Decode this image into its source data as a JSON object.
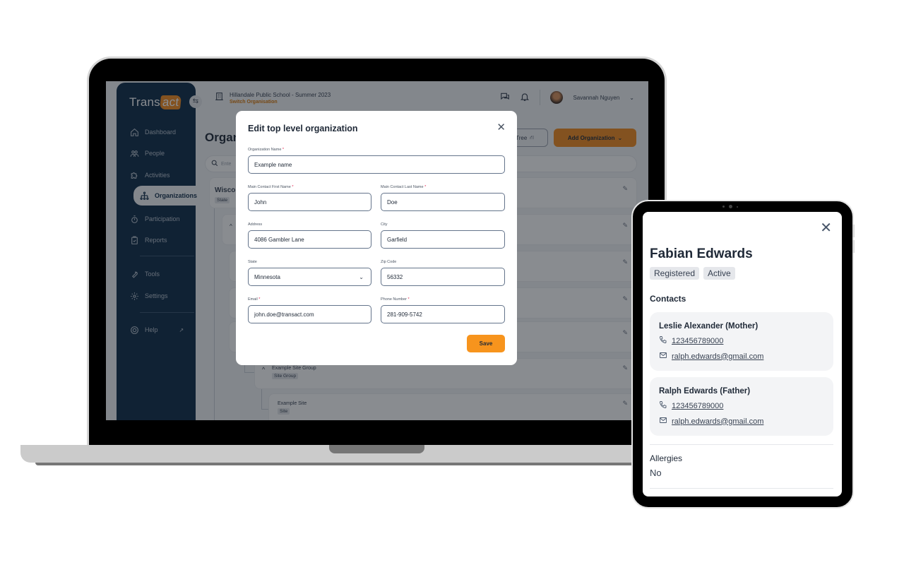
{
  "laptop": {
    "app": {
      "logo": {
        "prefix": "Trans",
        "suffix": "act"
      },
      "sidebar": {
        "items": [
          {
            "label": "Dashboard",
            "icon": "home-icon"
          },
          {
            "label": "People",
            "icon": "people-icon"
          },
          {
            "label": "Activities",
            "icon": "puzzle-icon"
          },
          {
            "label": "Organizations",
            "icon": "org-tree-icon",
            "active": true
          },
          {
            "label": "Participation",
            "icon": "stopwatch-icon"
          },
          {
            "label": "Reports",
            "icon": "clipboard-icon"
          },
          {
            "label": "Tools",
            "icon": "wrench-icon"
          },
          {
            "label": "Settings",
            "icon": "gear-icon"
          },
          {
            "label": "Help",
            "icon": "lifebuoy-icon"
          }
        ]
      },
      "topbar": {
        "org_name": "Hillandale Public School - Summer 2023",
        "switch_label": "Switch Organisation",
        "user_name": "Savannah Nguyen"
      },
      "page": {
        "title": "Organizations",
        "title_visible": "Orgar",
        "tree_button": "Tree",
        "tree_button_visible": "ree",
        "add_button": "Add Organization",
        "search_placeholder": "Ente",
        "rows": [
          {
            "title": "Wiscor",
            "badge": "State"
          },
          {
            "title": "Example Site Group",
            "badge": "Site Group"
          },
          {
            "title": "Example Site",
            "badge": "Site"
          }
        ]
      },
      "modal": {
        "title": "Edit top level organization",
        "fields": {
          "org_name": {
            "label": "Organization Name",
            "required": "*",
            "value": "Example name"
          },
          "first_name": {
            "label": "Main Contact First Name",
            "required": "*",
            "value": "John"
          },
          "last_name": {
            "label": "Main Contact Last Name",
            "required": "*",
            "value": "Doe"
          },
          "address": {
            "label": "Address",
            "value": "4086 Gambler Lane"
          },
          "city": {
            "label": "City",
            "value": "Garfield"
          },
          "state": {
            "label": "State",
            "value": "Minnesota"
          },
          "zip": {
            "label": "Zip Code",
            "value": "56332"
          },
          "email": {
            "label": "Email",
            "required": "*",
            "value": "john.doe@transact.com"
          },
          "phone": {
            "label": "Phone Number",
            "required": "*",
            "value": "281-909-5742"
          }
        },
        "save_label": "Save"
      }
    }
  },
  "tablet": {
    "name": "Fabian Edwards",
    "badges": [
      "Registered",
      "Active"
    ],
    "contacts_heading": "Contacts",
    "contacts": [
      {
        "name": "Leslie Alexander (Mother)",
        "phone": "123456789000",
        "email": "ralph.edwards@gmail.com"
      },
      {
        "name": "Ralph Edwards (Father)",
        "phone": "123456789000",
        "email": "ralph.edwards@gmail.com"
      }
    ],
    "allergies_heading": "Allergies",
    "allergies_value": "No"
  },
  "colors": {
    "sidebar_bg": "#0d2a47",
    "accent_orange": "#f7941d",
    "overlay": "rgba(20,26,33,0.5)"
  }
}
